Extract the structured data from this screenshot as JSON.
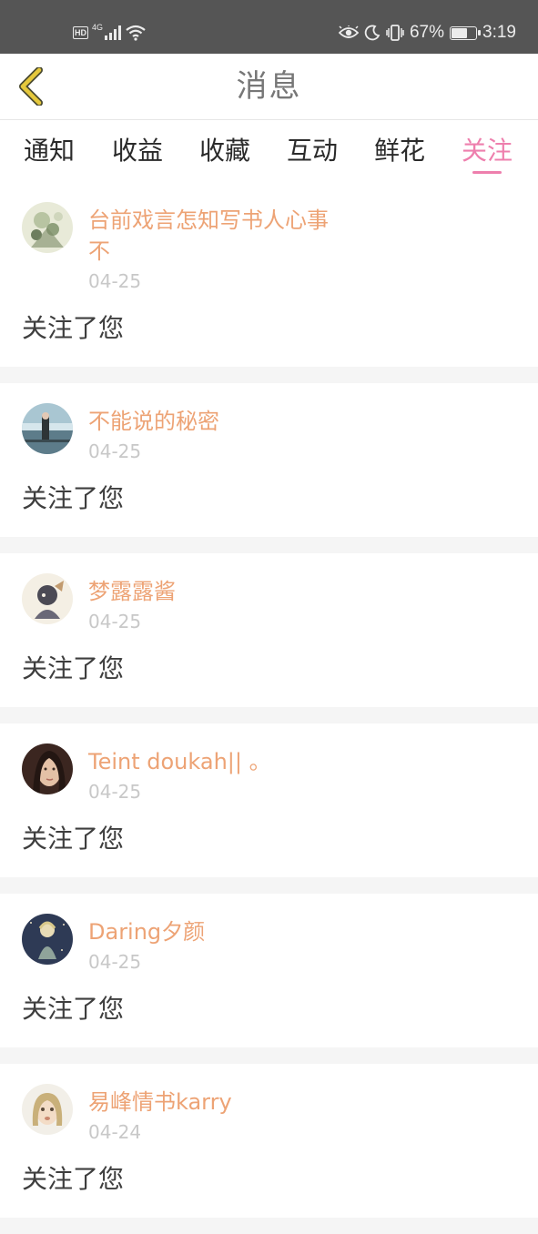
{
  "status_bar": {
    "hd": "HD",
    "network": "4G",
    "battery_percent": "67%",
    "battery_level": 0.67,
    "time": "3:19"
  },
  "header": {
    "title": "消息",
    "back_icon": "chevron-left-icon"
  },
  "tabs": [
    {
      "label": "通知"
    },
    {
      "label": "收益"
    },
    {
      "label": "收藏"
    },
    {
      "label": "互动"
    },
    {
      "label": "鲜花"
    },
    {
      "label": "关注",
      "active": true
    }
  ],
  "colors": {
    "accent_pink": "#ee7fad",
    "username_orange": "#eda375",
    "date_gray": "#c8c8c8"
  },
  "follows": [
    {
      "username": "台前戏言怎知写书人心事不",
      "date": "04-25",
      "action": "关注了您"
    },
    {
      "username": "不能说的秘密",
      "date": "04-25",
      "action": "关注了您"
    },
    {
      "username": "梦露露酱",
      "date": "04-25",
      "action": "关注了您"
    },
    {
      "username": "Teint doukah|| 。",
      "date": "04-25",
      "action": "关注了您"
    },
    {
      "username": "Daring夕颜",
      "date": "04-25",
      "action": "关注了您"
    },
    {
      "username": "易峰情书karry",
      "date": "04-24",
      "action": "关注了您"
    }
  ]
}
